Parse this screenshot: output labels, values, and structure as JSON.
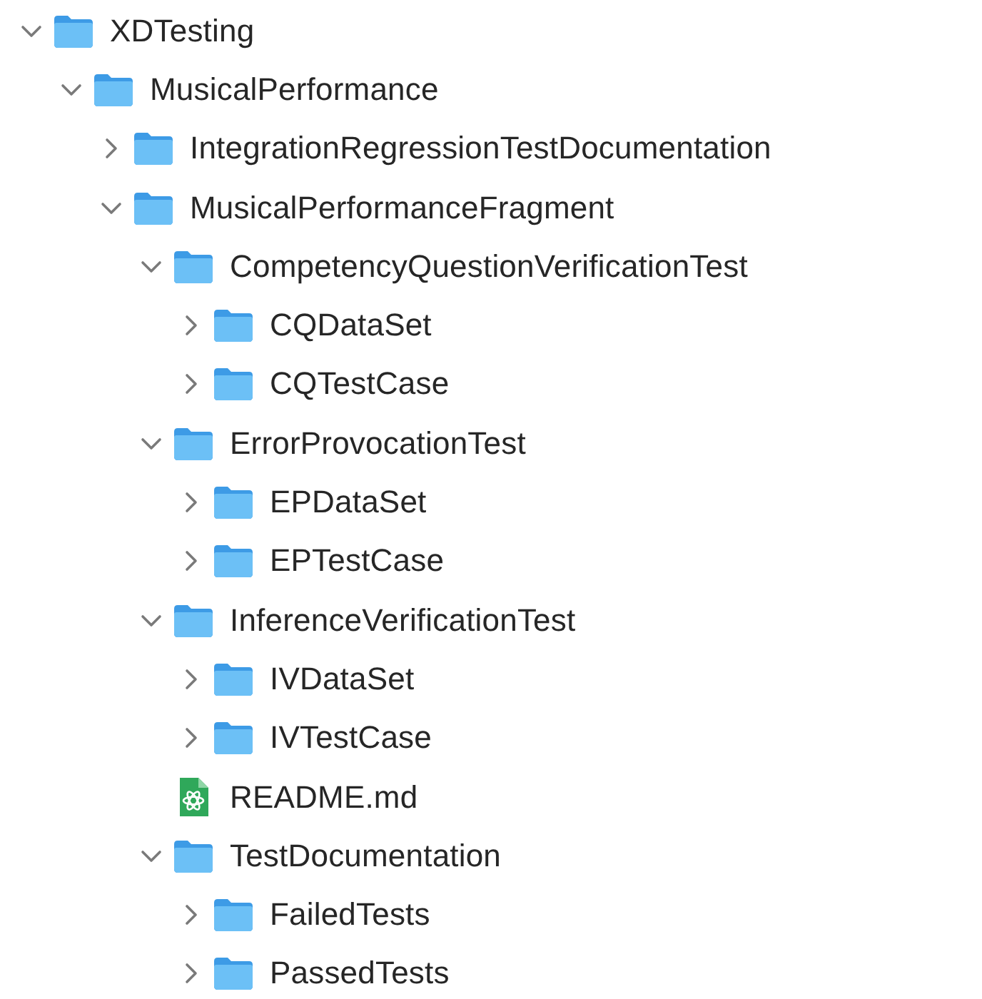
{
  "tree": [
    {
      "kind": "folder",
      "name": "XDTesting",
      "expanded": true,
      "children": [
        {
          "kind": "folder",
          "name": "MusicalPerformance",
          "expanded": true,
          "children": [
            {
              "kind": "folder",
              "name": "IntegrationRegressionTestDocumentation",
              "expanded": false
            },
            {
              "kind": "folder",
              "name": "MusicalPerformanceFragment",
              "expanded": true,
              "children": [
                {
                  "kind": "folder",
                  "name": "CompetencyQuestionVerificationTest",
                  "expanded": true,
                  "children": [
                    {
                      "kind": "folder",
                      "name": "CQDataSet",
                      "expanded": false
                    },
                    {
                      "kind": "folder",
                      "name": "CQTestCase",
                      "expanded": false
                    }
                  ]
                },
                {
                  "kind": "folder",
                  "name": "ErrorProvocationTest",
                  "expanded": true,
                  "children": [
                    {
                      "kind": "folder",
                      "name": "EPDataSet",
                      "expanded": false
                    },
                    {
                      "kind": "folder",
                      "name": "EPTestCase",
                      "expanded": false
                    }
                  ]
                },
                {
                  "kind": "folder",
                  "name": "InferenceVerificationTest",
                  "expanded": true,
                  "children": [
                    {
                      "kind": "folder",
                      "name": "IVDataSet",
                      "expanded": false
                    },
                    {
                      "kind": "folder",
                      "name": "IVTestCase",
                      "expanded": false
                    }
                  ]
                },
                {
                  "kind": "file",
                  "name": "README.md"
                },
                {
                  "kind": "folder",
                  "name": "TestDocumentation",
                  "expanded": true,
                  "children": [
                    {
                      "kind": "folder",
                      "name": "FailedTests",
                      "expanded": false
                    },
                    {
                      "kind": "folder",
                      "name": "PassedTests",
                      "expanded": false
                    }
                  ]
                }
              ]
            }
          ]
        }
      ]
    }
  ]
}
